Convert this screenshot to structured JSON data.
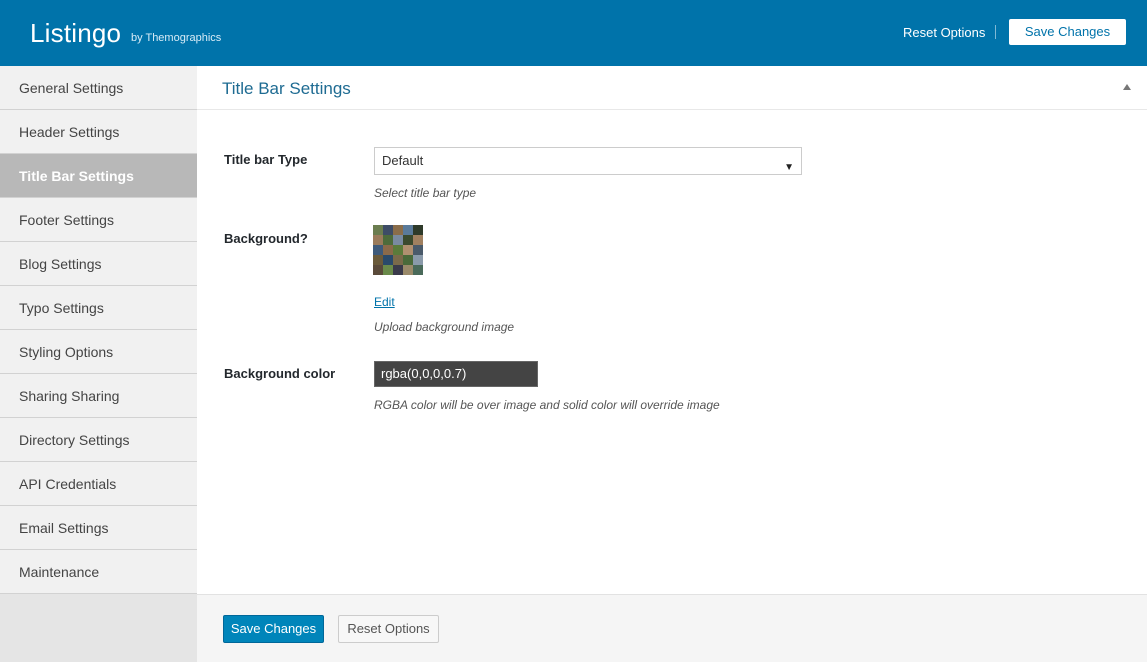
{
  "header": {
    "app_title": "Listingo",
    "byline": "by Themographics",
    "reset_label": "Reset Options",
    "save_label": "Save Changes"
  },
  "sidebar": {
    "active_index": 2,
    "items": [
      {
        "label": "General Settings"
      },
      {
        "label": "Header Settings"
      },
      {
        "label": "Title Bar Settings"
      },
      {
        "label": "Footer Settings"
      },
      {
        "label": "Blog Settings"
      },
      {
        "label": "Typo Settings"
      },
      {
        "label": "Styling Options"
      },
      {
        "label": "Sharing Sharing"
      },
      {
        "label": "Directory Settings"
      },
      {
        "label": "API Credentials"
      },
      {
        "label": "Email Settings"
      },
      {
        "label": "Maintenance"
      }
    ]
  },
  "section": {
    "title": "Title Bar Settings"
  },
  "fields": {
    "title_bar_type": {
      "label": "Title bar Type",
      "value": "Default",
      "description": "Select title bar type"
    },
    "background": {
      "label": "Background?",
      "edit_label": "Edit",
      "description": "Upload background image"
    },
    "background_color": {
      "label": "Background color",
      "value": "rgba(0,0,0,0.7)",
      "description": "RGBA color will be over image and solid color will override image"
    }
  },
  "footer": {
    "save_label": "Save Changes",
    "reset_label": "Reset Options"
  },
  "colors": {
    "header_bg": "#0073aa",
    "primary_button": "#0085ba",
    "active_sidebar": "#b8b8b8",
    "color_swatch": "#444444"
  }
}
